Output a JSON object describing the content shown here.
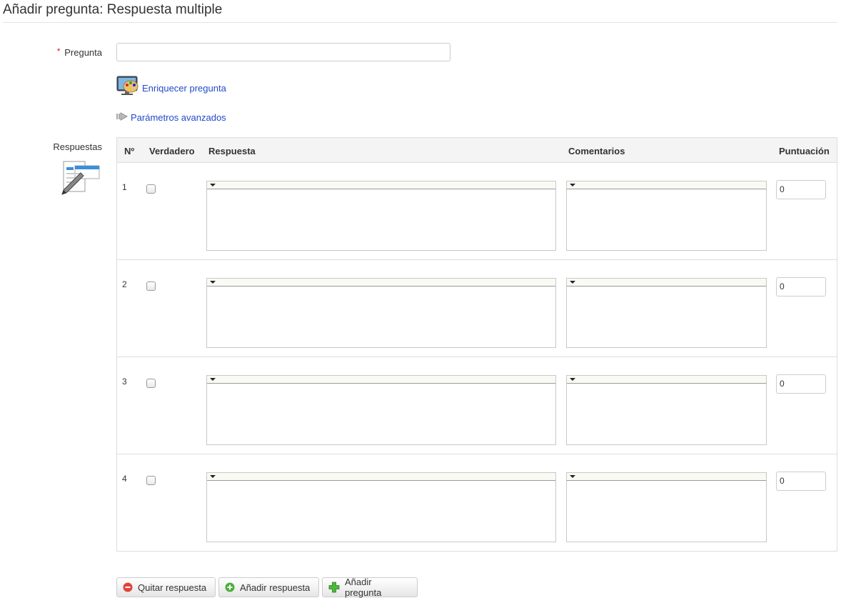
{
  "page": {
    "title": "Añadir pregunta: Respuesta multiple"
  },
  "question": {
    "required_star": "*",
    "label": "Pregunta",
    "value": "",
    "enrich_link": "Enriquecer pregunta",
    "advanced_link": "Parámetros avanzados"
  },
  "answers": {
    "label": "Respuestas",
    "columns": [
      "Nº",
      "Verdadero",
      "Respuesta",
      "Comentarios",
      "Puntuación"
    ],
    "rows": [
      {
        "num": "1",
        "correct": false,
        "answer": "",
        "comment": "",
        "score": "0"
      },
      {
        "num": "2",
        "correct": false,
        "answer": "",
        "comment": "",
        "score": "0"
      },
      {
        "num": "3",
        "correct": false,
        "answer": "",
        "comment": "",
        "score": "0"
      },
      {
        "num": "4",
        "correct": false,
        "answer": "",
        "comment": "",
        "score": "0"
      }
    ]
  },
  "buttons": {
    "remove_answer": "Quitar respuesta",
    "add_answer": "Añadir respuesta",
    "add_question": "Añadir pregunta"
  },
  "icons": {
    "enrich": "palette-monitor-icon",
    "advanced": "arrow-right-icon",
    "answers": "answers-pen-icon",
    "remove": "minus-circle-icon",
    "add_answer": "plus-circle-icon",
    "add_question": "plus-icon"
  },
  "colors": {
    "link": "#2149c9",
    "required": "#dd0000"
  }
}
